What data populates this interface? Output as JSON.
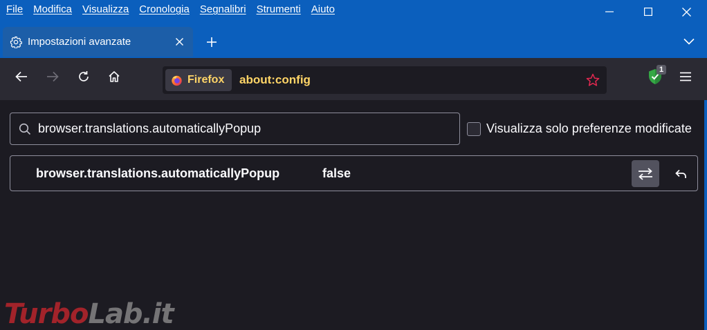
{
  "menu": [
    "File",
    "Modifica",
    "Visualizza",
    "Cronologia",
    "Segnalibri",
    "Strumenti",
    "Aiuto"
  ],
  "window_controls": {
    "minimize_icon": "minimize-icon",
    "maximize_icon": "maximize-icon",
    "close_icon": "close-icon"
  },
  "tab": {
    "title": "Impostazioni avanzate",
    "icon": "gear-icon"
  },
  "navbar": {
    "identity_label": "Firefox",
    "url": "about:config",
    "shield_badge": "1"
  },
  "search": {
    "value": "browser.translations.automaticallyPopup"
  },
  "filter": {
    "label": "Visualizza solo preferenze modificate",
    "checked": false
  },
  "preference": {
    "name": "browser.translations.automaticallyPopup",
    "value": "false"
  },
  "watermark": {
    "part1": "Turbo",
    "part2": "Lab.it"
  },
  "colors": {
    "titlebar": "#0b5fbd",
    "tab": "#1c5ea8",
    "toolbar": "#2b2a33",
    "content": "#1c1b22",
    "url_accent": "#ffd567"
  }
}
